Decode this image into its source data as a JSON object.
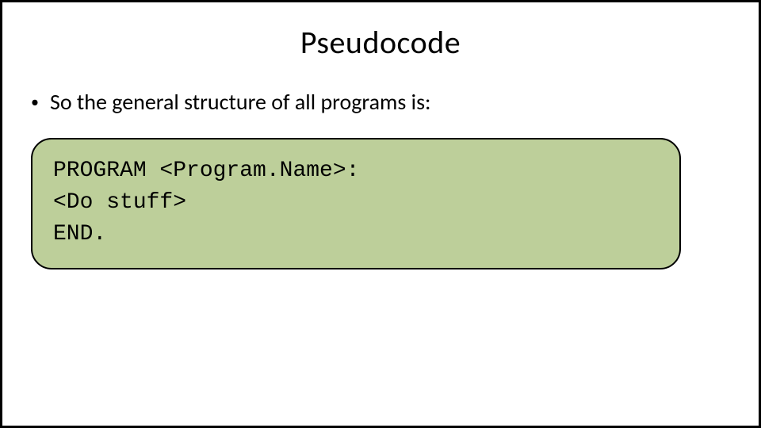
{
  "title": "Pseudocode",
  "bullet": "So the general structure of all programs is:",
  "code": {
    "line1": "PROGRAM <Program.Name>:",
    "line2": "<Do stuff>",
    "line3": "END."
  }
}
